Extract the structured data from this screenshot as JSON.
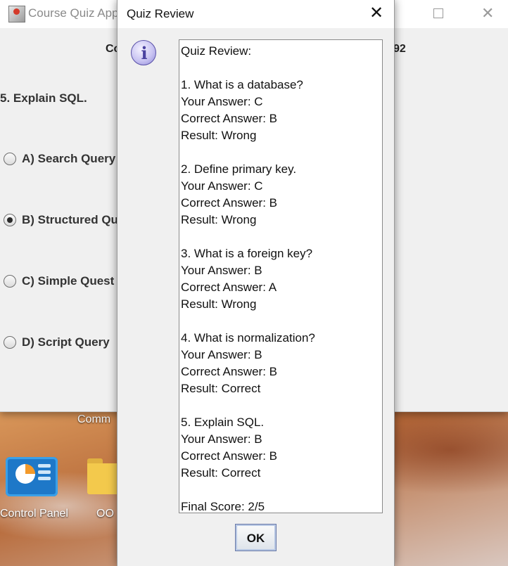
{
  "desktop": {
    "icons": [
      {
        "label": "Control Panel",
        "icon": "control-panel-icon"
      },
      {
        "label": "OO",
        "icon": "folder-icon"
      }
    ],
    "partial_label": "Comm"
  },
  "main_window": {
    "title": "Course Quiz App",
    "header_left": "Co",
    "header_right": "92",
    "question": "5. Explain SQL.",
    "options": [
      {
        "label": "A) Search Query",
        "selected": false
      },
      {
        "label": "B) Structured Qu",
        "selected": true
      },
      {
        "label": "C) Simple Quest",
        "selected": false
      },
      {
        "label": "D) Script Query",
        "selected": false
      }
    ]
  },
  "dialog": {
    "title": "Quiz Review",
    "close_glyph": "✕",
    "icon": "info-icon",
    "lines": [
      "Quiz Review:",
      "",
      "1. What is a database?",
      "Your Answer: C",
      "Correct Answer: B",
      "Result: Wrong",
      "",
      "2. Define primary key.",
      "Your Answer: C",
      "Correct Answer: B",
      "Result: Wrong",
      "",
      "3. What is a foreign key?",
      "Your Answer: B",
      "Correct Answer: A",
      "Result: Wrong",
      "",
      "4. What is normalization?",
      "Your Answer: B",
      "Correct Answer: B",
      "Result: Correct",
      "",
      "5. Explain SQL.",
      "Your Answer: B",
      "Correct Answer: B",
      "Result: Correct",
      "",
      "Final Score: 2/5"
    ],
    "ok_label": "OK"
  }
}
